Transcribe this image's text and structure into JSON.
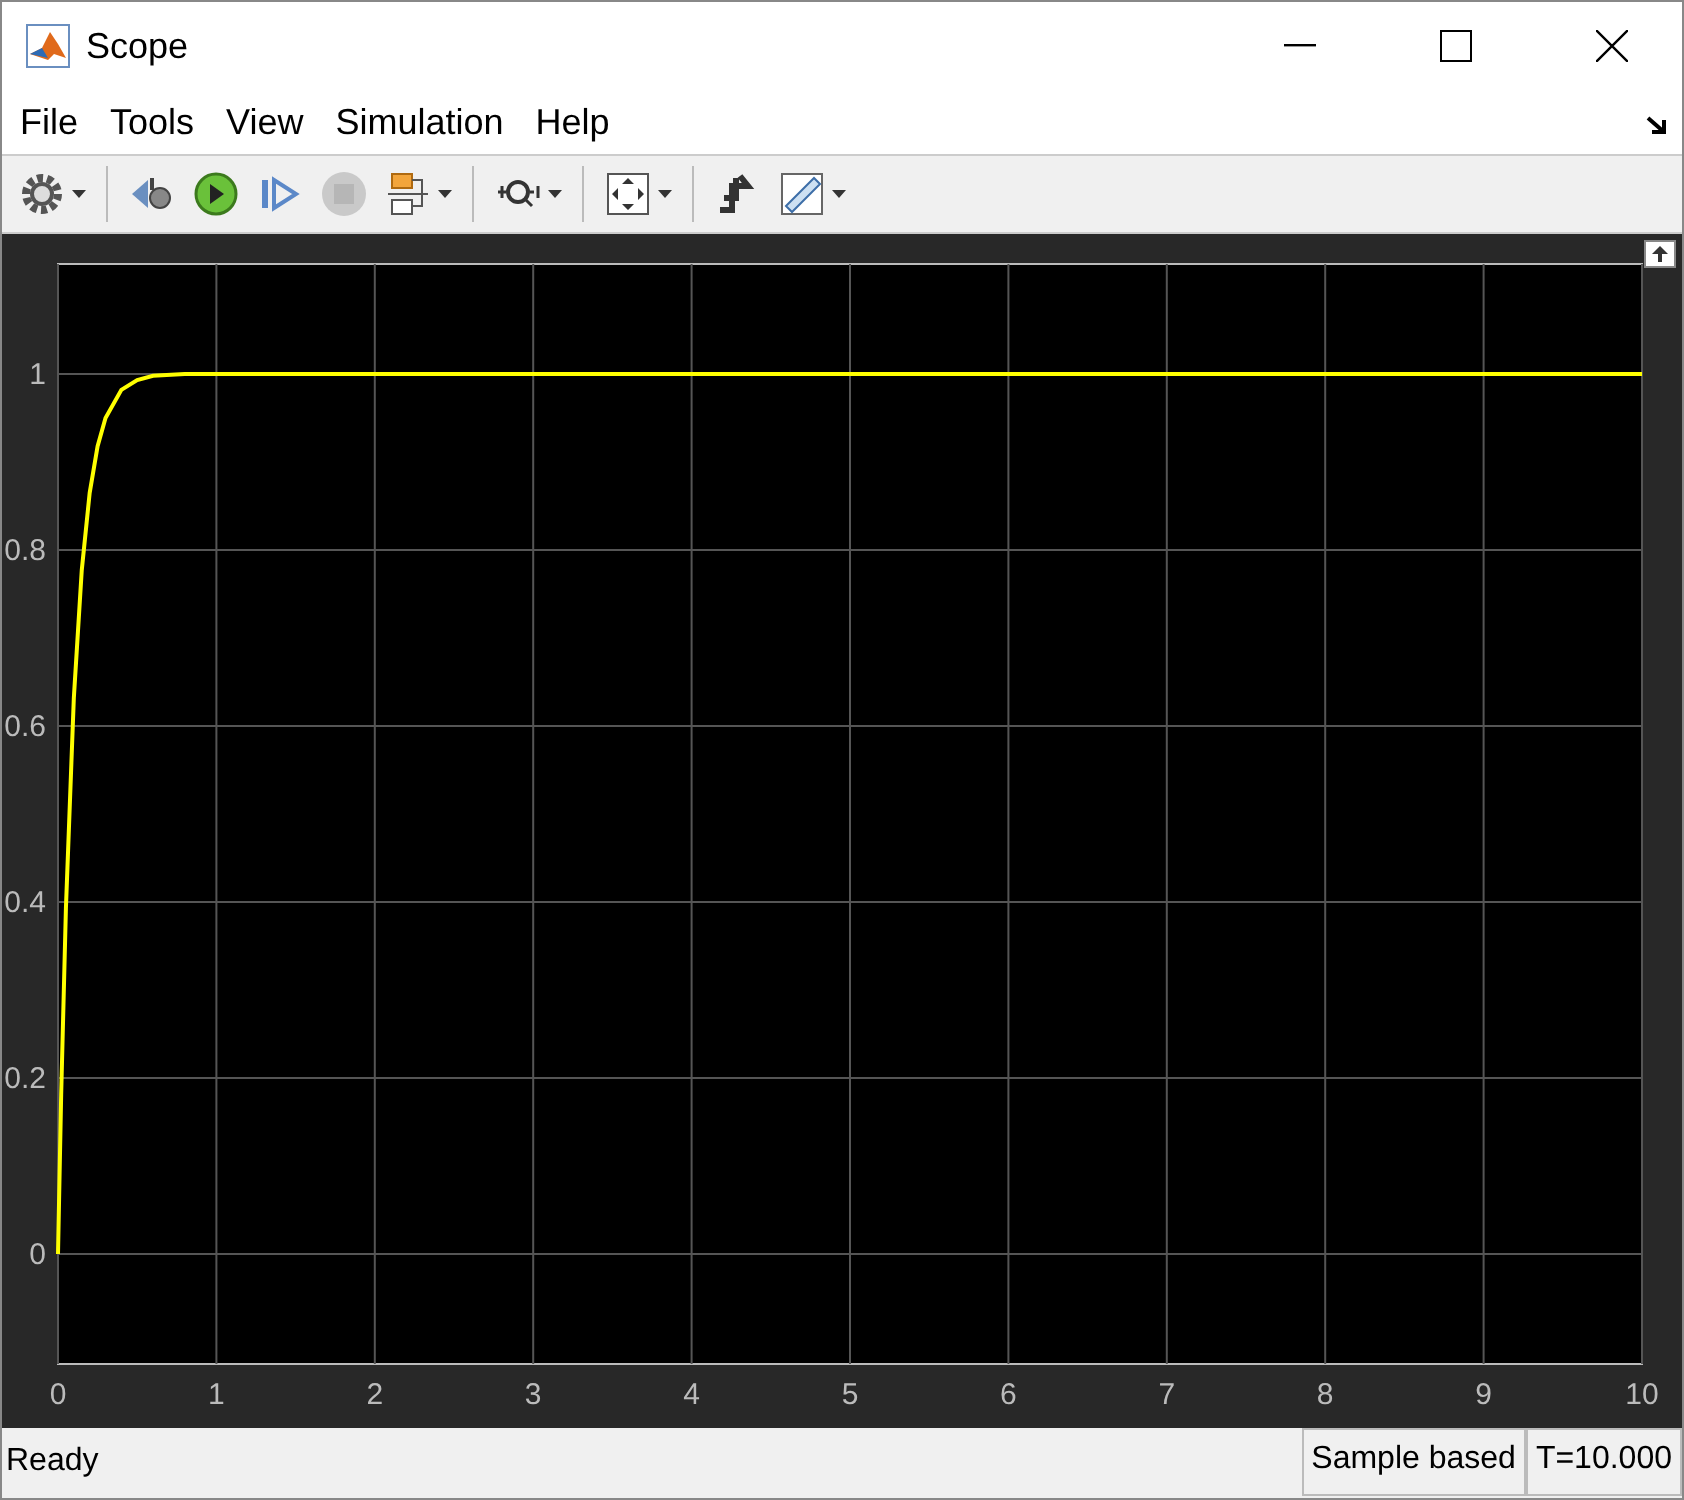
{
  "window": {
    "title": "Scope"
  },
  "menu": [
    "File",
    "Tools",
    "View",
    "Simulation",
    "Help"
  ],
  "toolbar": [
    {
      "kind": "gear",
      "caret": true
    },
    {
      "kind": "step-back",
      "caret": false
    },
    {
      "kind": "run",
      "caret": false
    },
    {
      "kind": "step-forward",
      "caret": false
    },
    {
      "kind": "stop",
      "caret": false,
      "disabled": true
    },
    {
      "kind": "highlight",
      "caret": true
    },
    {
      "kind": "zoom",
      "caret": true
    },
    {
      "kind": "fit",
      "caret": true
    },
    {
      "kind": "trigger",
      "caret": false
    },
    {
      "kind": "ruler",
      "caret": true
    }
  ],
  "plot": {
    "chart_data": {
      "type": "line",
      "x": [
        0,
        0.02,
        0.05,
        0.1,
        0.15,
        0.2,
        0.25,
        0.3,
        0.4,
        0.5,
        0.6,
        0.8,
        1,
        10
      ],
      "grid": true,
      "series": [
        {
          "color": "#ffff00",
          "values": [
            0,
            0.181,
            0.393,
            0.632,
            0.777,
            0.865,
            0.918,
            0.95,
            0.982,
            0.993,
            0.998,
            1,
            1,
            1
          ]
        }
      ],
      "xlim": [
        0,
        10
      ],
      "ylim": [
        -0.125,
        1.125
      ],
      "xticks": [
        0,
        1,
        2,
        3,
        4,
        5,
        6,
        7,
        8,
        9,
        10
      ],
      "yticks": [
        0,
        0.2,
        0.4,
        0.6,
        0.8,
        1
      ]
    }
  },
  "status": {
    "text": "Ready",
    "mode": "Sample based",
    "time": "T=10.000"
  }
}
